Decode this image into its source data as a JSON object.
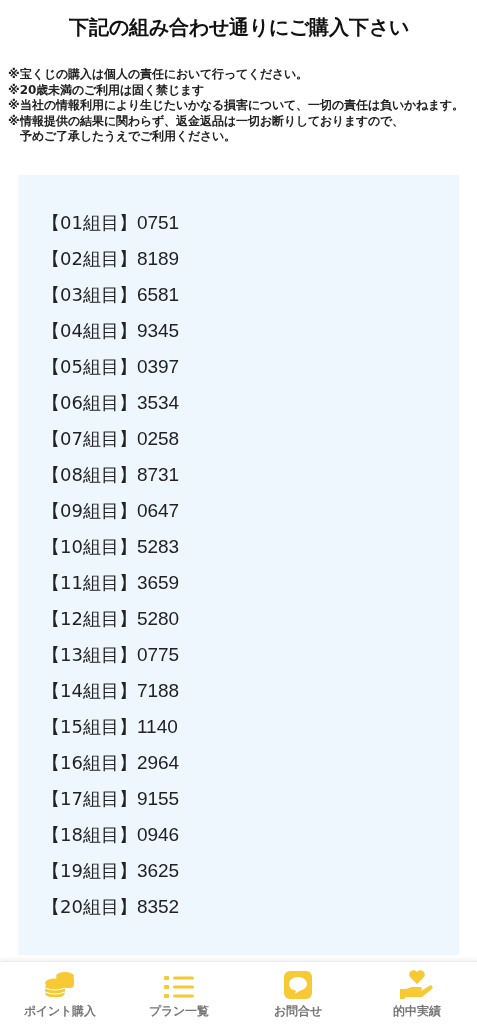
{
  "title": "下記の組み合わせ通りにご購入下さい",
  "notes": [
    {
      "lines": [
        "※宝くじの購入は個人の責任において行ってください。"
      ]
    },
    {
      "lines": [
        "※20歳未満のご利用は固く禁じます"
      ]
    },
    {
      "lines": [
        "※当社の情報利用により生じたいかなる損害について、一切の責任は負いかねます。"
      ]
    },
    {
      "lines": [
        "※情報提供の結果に関わらず、返金返品は一切お断りしておりますので、",
        "予めご了承したうえでご利用ください。"
      ]
    }
  ],
  "combinations": [
    {
      "label": "【01組目】",
      "number": "0751"
    },
    {
      "label": "【02組目】",
      "number": "8189"
    },
    {
      "label": "【03組目】",
      "number": "6581"
    },
    {
      "label": "【04組目】",
      "number": "9345"
    },
    {
      "label": "【05組目】",
      "number": "0397"
    },
    {
      "label": "【06組目】",
      "number": "3534"
    },
    {
      "label": "【07組目】",
      "number": "0258"
    },
    {
      "label": "【08組目】",
      "number": "8731"
    },
    {
      "label": "【09組目】",
      "number": "0647"
    },
    {
      "label": "【10組目】",
      "number": "5283"
    },
    {
      "label": "【11組目】",
      "number": "3659"
    },
    {
      "label": "【12組目】",
      "number": "5280"
    },
    {
      "label": "【13組目】",
      "number": "0775"
    },
    {
      "label": "【14組目】",
      "number": "7188"
    },
    {
      "label": "【15組目】",
      "number": "1140"
    },
    {
      "label": "【16組目】",
      "number": "2964"
    },
    {
      "label": "【17組目】",
      "number": "9155"
    },
    {
      "label": "【18組目】",
      "number": "0946"
    },
    {
      "label": "【19組目】",
      "number": "3625"
    },
    {
      "label": "【20組目】",
      "number": "8352"
    }
  ],
  "bottom_nav": [
    {
      "kind": "coins",
      "label": "ポイント購入"
    },
    {
      "kind": "list",
      "label": "プラン一覧"
    },
    {
      "kind": "chat",
      "label": "お問合せ"
    },
    {
      "kind": "heart-hand",
      "label": "的中実績"
    }
  ]
}
